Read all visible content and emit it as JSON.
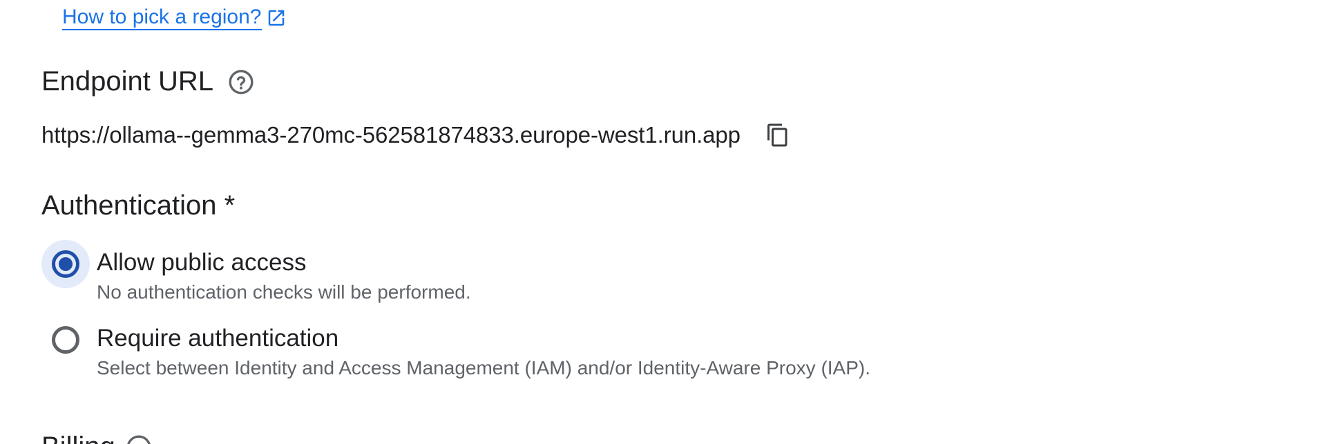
{
  "region_help": {
    "link_text": "How to pick a region?",
    "icon": "external-link-icon"
  },
  "endpoint": {
    "heading": "Endpoint URL",
    "help_icon": "help-circle-icon",
    "url": "https://ollama--gemma3-270mc-562581874833.europe-west1.run.app",
    "copy_icon": "copy-icon"
  },
  "authentication": {
    "heading": "Authentication *",
    "options": [
      {
        "label": "Allow public access",
        "description": "No authentication checks will be performed.",
        "selected": true
      },
      {
        "label": "Require authentication",
        "description": "Select between Identity and Access Management (IAM) and/or Identity-Aware Proxy (IAP).",
        "selected": false
      }
    ]
  },
  "next_section": {
    "heading": "Billing",
    "help_icon": "help-circle-icon"
  },
  "colors": {
    "link": "#1a73e8",
    "radio_selected": "#1f4fa8",
    "radio_halo": "#e3eaf9",
    "text_primary": "#202124",
    "text_secondary": "#5f6368"
  }
}
